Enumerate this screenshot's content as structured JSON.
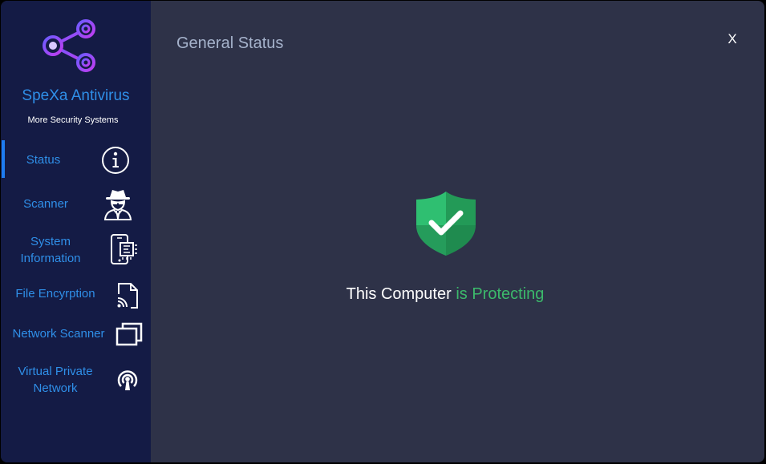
{
  "app": {
    "name": "SpeXa Antivirus",
    "tagline": "More Security Systems",
    "accent_color": "#2f8fe8",
    "sidebar_color": "#141b45",
    "main_color": "#2e3248"
  },
  "sidebar": {
    "items": [
      {
        "label": "Status",
        "icon": "info-icon",
        "active": true
      },
      {
        "label": "Scanner",
        "icon": "spy-agent-icon",
        "active": false
      },
      {
        "label": "System\nInformation",
        "icon": "phone-chip-icon",
        "active": false
      },
      {
        "label": "File Encyrption",
        "icon": "file-cast-icon",
        "active": false
      },
      {
        "label": "Network Scanner",
        "icon": "windows-stack-icon",
        "active": false
      },
      {
        "label": "Virtual Private\nNetwork",
        "icon": "antenna-broadcast-icon",
        "active": false
      }
    ]
  },
  "main": {
    "title": "General Status",
    "close_label": "X",
    "status_prefix": "This Computer",
    "status_suffix": "is Protecting",
    "status_color": "#3cb96b",
    "status_icon": "shield-check-icon"
  }
}
